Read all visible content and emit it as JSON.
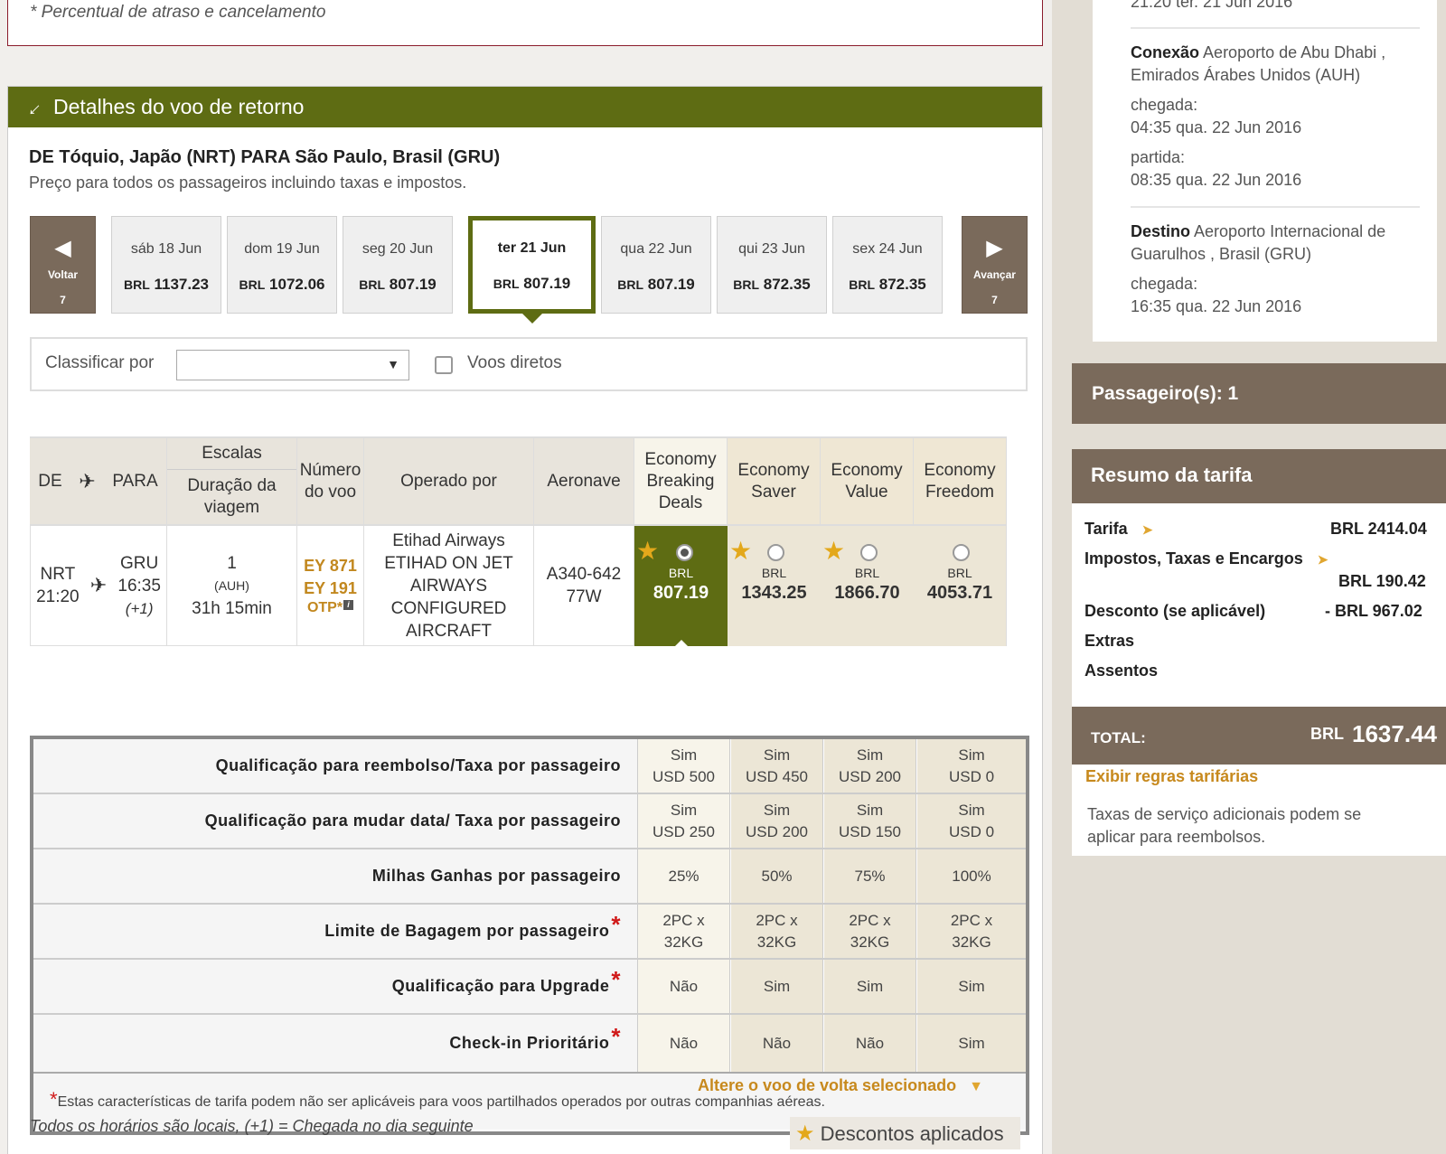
{
  "top_note": "* Percentual de atraso e cancelamento",
  "section": {
    "title": "Detalhes do voo de retorno",
    "route": "DE Tóquio, Japão (NRT) PARA São Paulo, Brasil (GRU)",
    "price_note": "Preço para todos os passageiros incluindo taxas e impostos."
  },
  "date_nav": {
    "prev": {
      "label": "Voltar",
      "count": "7"
    },
    "next": {
      "label": "Avançar",
      "count": "7"
    },
    "dates": [
      {
        "date": "sáb 18 Jun",
        "currency": "BRL",
        "price": "1137.23"
      },
      {
        "date": "dom 19 Jun",
        "currency": "BRL",
        "price": "1072.06"
      },
      {
        "date": "seg 20 Jun",
        "currency": "BRL",
        "price": "807.19"
      },
      {
        "date": "ter 21 Jun",
        "currency": "BRL",
        "price": "807.19",
        "selected": true
      },
      {
        "date": "qua 22 Jun",
        "currency": "BRL",
        "price": "807.19"
      },
      {
        "date": "qui 23 Jun",
        "currency": "BRL",
        "price": "872.35"
      },
      {
        "date": "sex 24 Jun",
        "currency": "BRL",
        "price": "872.35"
      }
    ]
  },
  "sort": {
    "label": "Classificar por",
    "value": "",
    "direct_label": "Voos diretos"
  },
  "table": {
    "headers": {
      "de": "DE",
      "para": "PARA",
      "escalas": "Escalas",
      "duracao": "Duração da viagem",
      "numero": "Número do voo",
      "operado": "Operado por",
      "aeronave": "Aeronave",
      "fares": [
        "Economy Breaking Deals",
        "Economy Saver",
        "Economy Value",
        "Economy Freedom"
      ]
    },
    "flight": {
      "from_code": "NRT",
      "from_time": "21:20",
      "to_code": "GRU",
      "to_time": "16:35",
      "plus": "(+1)",
      "stops": "1",
      "via": "(AUH)",
      "duration": "31h 15min",
      "numbers": [
        "EY 871",
        "EY 191"
      ],
      "otp": "OTP*",
      "operator": "Etihad Airways ETIHAD ON JET AIRWAYS CONFIGURED AIRCRAFT",
      "aircraft": "A340-642 77W",
      "fares": [
        {
          "currency": "BRL",
          "price": "807.19",
          "star": true,
          "selected": true
        },
        {
          "currency": "BRL",
          "price": "1343.25",
          "star": true,
          "selected": false
        },
        {
          "currency": "BRL",
          "price": "1866.70",
          "star": true,
          "selected": false
        },
        {
          "currency": "BRL",
          "price": "4053.71",
          "star": false,
          "selected": false
        }
      ]
    }
  },
  "details": {
    "rows": [
      {
        "label": "Qualificação para reembolso/Taxa por passageiro",
        "req": false,
        "values": [
          [
            "Sim",
            "USD 500"
          ],
          [
            "Sim",
            "USD 450"
          ],
          [
            "Sim",
            "USD 200"
          ],
          [
            "Sim",
            "USD 0"
          ]
        ]
      },
      {
        "label": "Qualificação para mudar data/ Taxa por passageiro",
        "req": false,
        "values": [
          [
            "Sim",
            "USD 250"
          ],
          [
            "Sim",
            "USD 200"
          ],
          [
            "Sim",
            "USD 150"
          ],
          [
            "Sim",
            "USD 0"
          ]
        ]
      },
      {
        "label": "Milhas Ganhas por passageiro",
        "req": false,
        "values": [
          [
            "25%"
          ],
          [
            "50%"
          ],
          [
            "75%"
          ],
          [
            "100%"
          ]
        ]
      },
      {
        "label": "Limite de Bagagem por passageiro",
        "req": true,
        "values": [
          [
            "2PC x",
            "32KG"
          ],
          [
            "2PC x",
            "32KG"
          ],
          [
            "2PC x",
            "32KG"
          ],
          [
            "2PC x",
            "32KG"
          ]
        ]
      },
      {
        "label": "Qualificação para Upgrade",
        "req": true,
        "values": [
          [
            "Não"
          ],
          [
            "Sim"
          ],
          [
            "Sim"
          ],
          [
            "Sim"
          ]
        ]
      },
      {
        "label": "Check-in Prioritário",
        "req": true,
        "values": [
          [
            "Não"
          ],
          [
            "Não"
          ],
          [
            "Não"
          ],
          [
            "Sim"
          ]
        ]
      }
    ],
    "footnote": "Estas características de tarifa podem não ser aplicáveis para voos partilhados operados por outras companhias aéreas."
  },
  "change_link": "Altere o voo de volta selecionado",
  "times_note": "Todos os horários são locais, (+1) = Chegada no dia seguinte",
  "discount_badge": "Descontos aplicados",
  "sidebar": {
    "itinerary": {
      "top_partial": "21:20 ter. 21 Jun 2016",
      "connection_label": "Conexão",
      "connection_place": "Aeroporto de Abu Dhabi , Emirados Árabes Unidos (AUH)",
      "arrival_label": "chegada:",
      "connection_arrival": "04:35 qua. 22 Jun 2016",
      "departure_label": "partida:",
      "connection_departure": "08:35 qua. 22 Jun 2016",
      "destination_label": "Destino",
      "destination_place": "Aeroporto Internacional de Guarulhos , Brasil (GRU)",
      "destination_arrival": "16:35 qua. 22 Jun 2016"
    },
    "passengers": "Passageiro(s): 1",
    "fare_summary": {
      "title": "Resumo da tarifa",
      "tarifa_label": "Tarifa",
      "tarifa_value": "BRL 2414.04",
      "impostos_label": "Impostos, Taxas e Encargos",
      "impostos_value": "BRL 190.42",
      "desconto_label": "Desconto (se aplicável)",
      "desconto_value": "- BRL 967.02",
      "extras_label": "Extras",
      "assentos_label": "Assentos",
      "total_label": "TOTAL:",
      "total_currency": "BRL",
      "total_amount": "1637.44",
      "rules_link": "Exibir regras tarifárias",
      "service_note": "Taxas de serviço adicionais podem se aplicar para reembolsos."
    }
  }
}
